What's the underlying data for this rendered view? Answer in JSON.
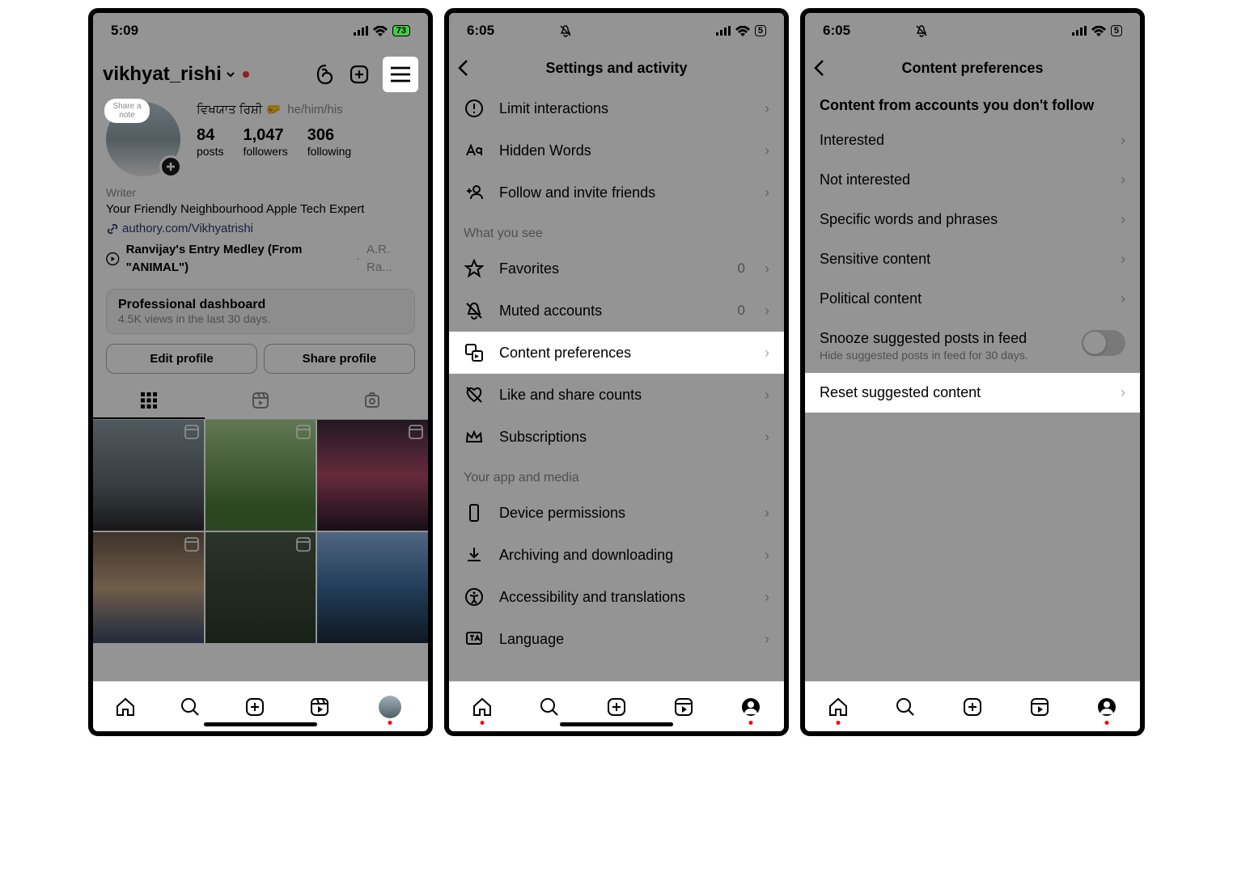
{
  "screen1": {
    "time": "5:09",
    "battery": "73",
    "username": "vikhyat_rishi",
    "note": "Share a note",
    "display_name": "ਵਿਖਯਾਤ ਰਿਸ਼ੀ 🤛",
    "pronouns": "he/him/his",
    "stats": {
      "posts": {
        "n": "84",
        "l": "posts"
      },
      "followers": {
        "n": "1,047",
        "l": "followers"
      },
      "following": {
        "n": "306",
        "l": "following"
      }
    },
    "category": "Writer",
    "bio": "Your Friendly Neighbourhood Apple Tech Expert",
    "link": "authory.com/Vikhyatrishi",
    "music_title": "Ranvijay's Entry Medley (From \"ANIMAL\")",
    "music_artist": "A.R. Ra...",
    "dash_title": "Professional dashboard",
    "dash_sub": "4.5K views in the last 30 days.",
    "edit": "Edit profile",
    "share": "Share profile"
  },
  "screen2": {
    "time": "6:05",
    "battery": "5",
    "title": "Settings and activity",
    "items": {
      "limit": "Limit interactions",
      "hidden": "Hidden Words",
      "follow": "Follow and invite friends",
      "sec_what": "What you see",
      "favorites": "Favorites",
      "fav_count": "0",
      "muted": "Muted accounts",
      "muted_count": "0",
      "content_pref": "Content preferences",
      "like_share": "Like and share counts",
      "subs": "Subscriptions",
      "sec_app": "Your app and media",
      "device": "Device permissions",
      "archive": "Archiving and downloading",
      "access": "Accessibility and translations",
      "lang": "Language"
    }
  },
  "screen3": {
    "time": "6:05",
    "battery": "5",
    "title": "Content preferences",
    "heading": "Content from accounts you don't follow",
    "items": {
      "interested": "Interested",
      "not_interested": "Not interested",
      "words": "Specific words and phrases",
      "sensitive": "Sensitive content",
      "political": "Political content",
      "snooze": "Snooze suggested posts in feed",
      "snooze_sub": "Hide suggested posts in feed for 30 days.",
      "reset": "Reset suggested content"
    }
  }
}
